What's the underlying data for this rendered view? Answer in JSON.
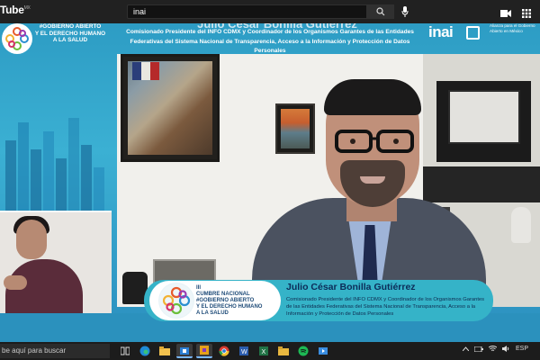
{
  "browser": {
    "logo_text": "Tube",
    "logo_region": "MX",
    "search_value": "inai"
  },
  "video": {
    "top_banner": {
      "event_logo_text_1": "#GOBIERNO ABIERTO",
      "event_logo_text_2": "Y EL DERECHO HUMANO",
      "event_logo_text_3": "A LA SALUD",
      "speaker_name": "Julio César Bonilla Gutiérrez",
      "speaker_title": "Comisionado Presidente del INFO CDMX y Coordinador de los Organismos Garantes de las Entidades Federativas del Sistema Nacional de Transparencia, Acceso a la Información y Protección de Datos Personales",
      "inai_logo": "inai",
      "alianza_text": "Alianza para el Gobierno Abierto en México"
    },
    "lower_third": {
      "logo_line_1": "III",
      "logo_line_2": "CUMBRE NACIONAL",
      "logo_line_3": "#GOBIERNO ABIERTO",
      "logo_line_4": "Y EL DERECHO HUMANO",
      "logo_line_5": "A LA SALUD",
      "name": "Julio César Bonilla Gutiérrez",
      "title": "Comisionado Presidente del INFO CDMX y Coordinador de los Organismos Garantes de las Entidades Federativas del Sistema Nacional de Transparencia, Acceso a la Información y Protección de Datos Personales"
    }
  },
  "taskbar": {
    "search_placeholder": "be aquí para buscar",
    "tray_lang": "ESP",
    "icons": [
      "task-view-icon",
      "edge-icon",
      "file-explorer-icon",
      "store-icon",
      "app-icon",
      "chrome-icon",
      "word-icon",
      "excel-icon",
      "folder-icon",
      "spotify-icon",
      "video-icon"
    ]
  },
  "colors": {
    "teal": "#35b3c8",
    "navy": "#0c2c58",
    "youtube_bar": "#212121"
  }
}
